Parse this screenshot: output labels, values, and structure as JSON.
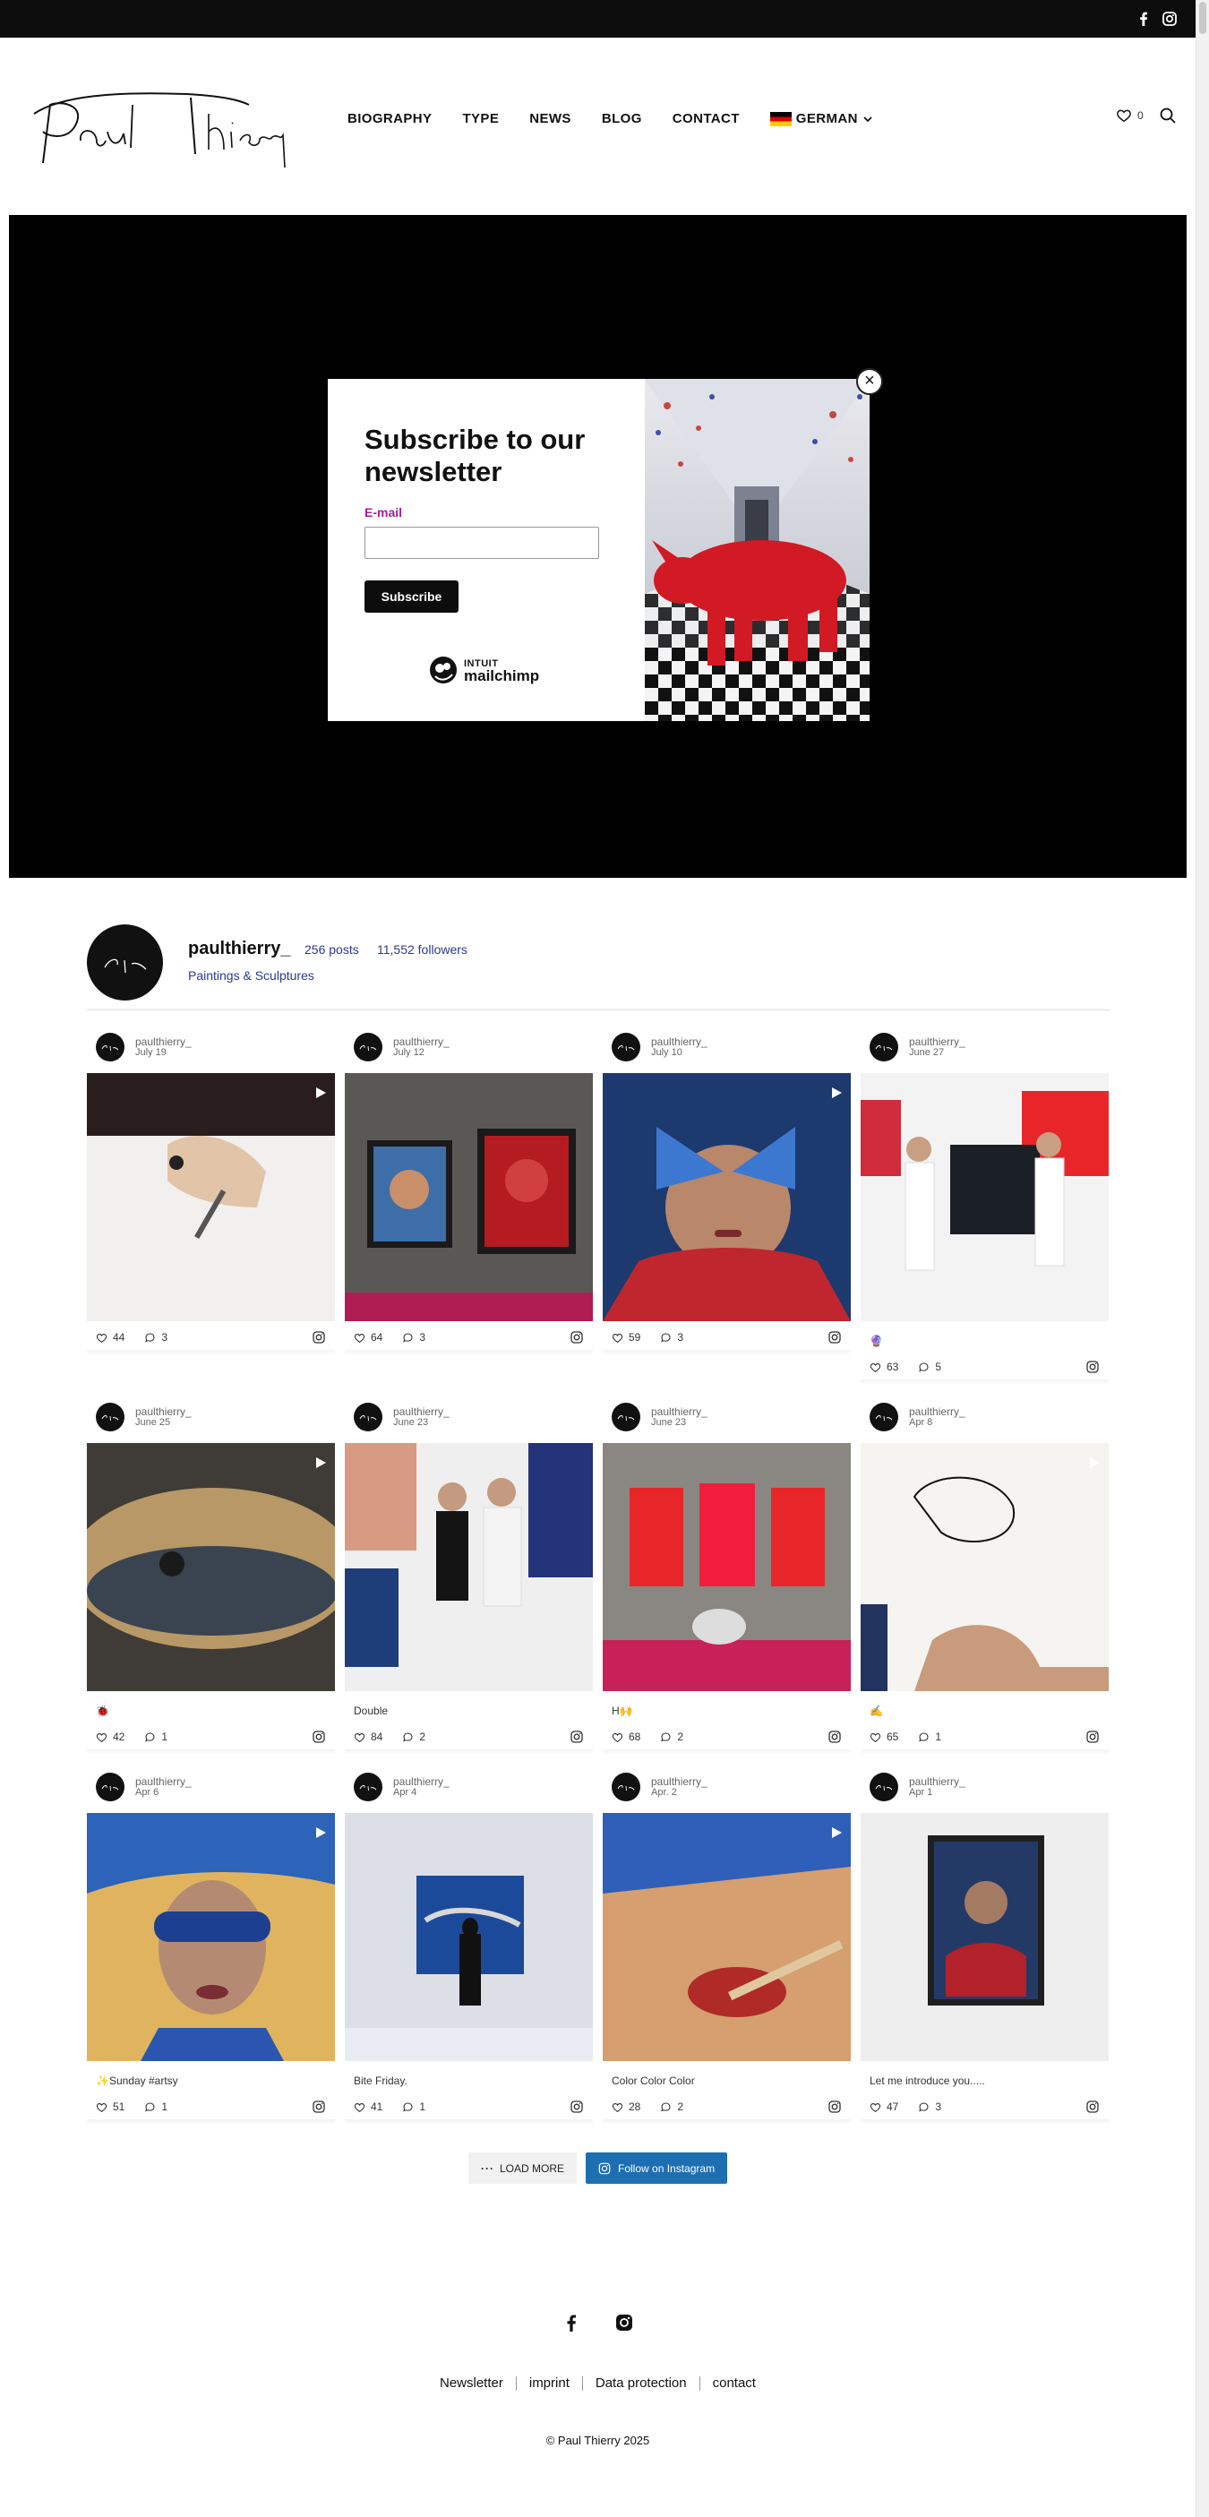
{
  "header": {
    "nav": [
      {
        "label": "BIOGRAPHY"
      },
      {
        "label": "TYPE"
      },
      {
        "label": "NEWS"
      },
      {
        "label": "BLOG"
      },
      {
        "label": "CONTACT"
      }
    ],
    "language": "GERMAN",
    "wishlist_count": "0"
  },
  "popup": {
    "title": "Subscribe to our newsletter",
    "email_label": "E-mail",
    "email_value": "",
    "subscribe_label": "Subscribe",
    "mailchimp_line1": "INTUIT",
    "mailchimp_line2": "mailchimp",
    "close_glyph": "×"
  },
  "profile": {
    "username": "paulthierry_",
    "posts": "256 posts",
    "followers": "11,552 followers",
    "bio": "Paintings & Sculptures"
  },
  "posts": [
    {
      "user": "paulthierry_",
      "date": "July 19",
      "caption": "",
      "likes": "44",
      "comments": "3",
      "video": true
    },
    {
      "user": "paulthierry_",
      "date": "July 12",
      "caption": "",
      "likes": "64",
      "comments": "3",
      "video": false
    },
    {
      "user": "paulthierry_",
      "date": "July 10",
      "caption": "",
      "likes": "59",
      "comments": "3",
      "video": true
    },
    {
      "user": "paulthierry_",
      "date": "June 27",
      "caption": "🔮",
      "likes": "63",
      "comments": "5",
      "video": false
    },
    {
      "user": "paulthierry_",
      "date": "June 25",
      "caption": "🐞",
      "likes": "42",
      "comments": "1",
      "video": true
    },
    {
      "user": "paulthierry_",
      "date": "June 23",
      "caption": "Double",
      "likes": "84",
      "comments": "2",
      "video": false
    },
    {
      "user": "paulthierry_",
      "date": "June 23",
      "caption": "H🙌",
      "likes": "68",
      "comments": "2",
      "video": false
    },
    {
      "user": "paulthierry_",
      "date": "Apr 8",
      "caption": "✍️",
      "likes": "65",
      "comments": "1",
      "video": true
    },
    {
      "user": "paulthierry_",
      "date": "Apr 6",
      "caption": "✨Sunday #artsy",
      "likes": "51",
      "comments": "1",
      "video": true
    },
    {
      "user": "paulthierry_",
      "date": "Apr 4",
      "caption": "Bite Friday.",
      "likes": "41",
      "comments": "1",
      "video": false
    },
    {
      "user": "paulthierry_",
      "date": "Apr. 2",
      "caption": "Color Color Color",
      "likes": "28",
      "comments": "2",
      "video": true
    },
    {
      "user": "paulthierry_",
      "date": "Apr 1",
      "caption": "Let me introduce you.....",
      "likes": "47",
      "comments": "3",
      "video": false
    }
  ],
  "buttons": {
    "load_more": "LOAD MORE",
    "follow": "Follow on Instagram"
  },
  "footer": {
    "links": [
      "Newsletter",
      "imprint",
      "Data protection",
      "contact"
    ],
    "copyright": "© Paul Thierry 2025"
  },
  "colors": {
    "topbar": "#0c0c0c",
    "hero": "#000000",
    "link_blue": "#2a3a8f",
    "follow_button": "#1d6fb2",
    "email_label": "#a020a0"
  }
}
